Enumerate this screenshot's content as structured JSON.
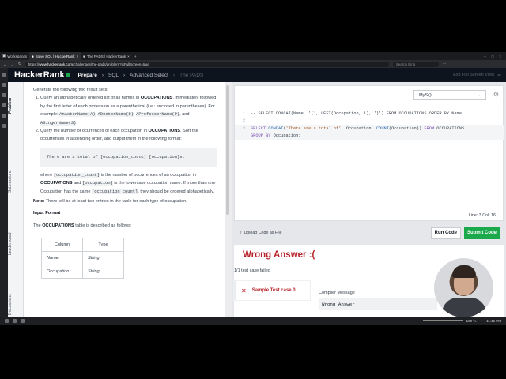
{
  "browser": {
    "tabs": [
      {
        "label": "Workspaces",
        "active": false
      },
      {
        "label": "Solve SQL | HackerRank",
        "active": true
      },
      {
        "label": "The PADS | HackerRank",
        "active": false
      }
    ],
    "url_prefix": "https://",
    "url_domain": "www.hackerrank.com",
    "url_path": "/challenges/the-pads/problem?isFullScreen=true",
    "search_placeholder": "Search Bing"
  },
  "header": {
    "logo": "HackerRank",
    "crumbs": [
      "Prepare",
      "SQL",
      "Advanced Select",
      "The PADS"
    ],
    "exit_fullscreen": "Exit Full Screen View"
  },
  "sidebar": {
    "tabs": [
      "Problem",
      "Submissions",
      "Leaderboard",
      "Discussions"
    ]
  },
  "problem": {
    "intro": "Generate the following two result sets:",
    "item1": {
      "pre": "Query an alphabetically ordered list of all names in ",
      "table": "OCCUPATIONS",
      "mid": ", immediately followed by the first letter of each profession as a parenthetical (i.e.: enclosed in parentheses). For example: ",
      "ex1": "AnActorName(A)",
      "sep1": ", ",
      "ex2": "ADoctorName(D)",
      "sep2": ", ",
      "ex3": "AProfessorName(P)",
      "sep3": ", and ",
      "ex4": "ASingerName(S)",
      "end": "."
    },
    "item2": {
      "pre": "Query the number of ocurrences of each occupation in ",
      "table": "OCCUPATIONS",
      "post": ". Sort the occurrences in ascending order, and output them in the following format:"
    },
    "format_code": "There are a total of [occupation_count] [occupation]s.",
    "where": {
      "w1": "where ",
      "c1": "[occupation_count]",
      "w2": " is the number of occurrences of an occupation in ",
      "t1": "OCCUPATIONS",
      "w3": " and ",
      "c2": "[occupation]",
      "w4": " is the lowercase occupation name. If more than one Occupation has the same ",
      "c3": "[occupation_count]",
      "w5": ", they should be ordered alphabetically."
    },
    "note_label": "Note:",
    "note_text": " There will be at least two entries in the table for each type of occupation.",
    "input_format": "Input Format",
    "table_desc_pre": "The ",
    "table_desc_name": "OCCUPATIONS",
    "table_desc_post": " table is described as follows:",
    "columns_header": [
      "Column",
      "Type"
    ],
    "columns": [
      [
        "Name",
        "String"
      ],
      [
        "Occupation",
        "String"
      ]
    ]
  },
  "editor": {
    "language": "MySQL",
    "line_numbers": [
      "1",
      "2",
      "3"
    ],
    "line1": "-- SELECT CONCAT(Name, '(', LEFT(Occupation, 1), ')') FROM OCCUPATIONS ORDER BY Name;",
    "line3_kw1": "SELECT ",
    "line3_fn1": "CONCAT",
    "line3_p1": "(",
    "line3_str": "'There are a total of'",
    "line3_p2": ", Occupation, ",
    "line3_fn2": "COUNT",
    "line3_p3": "(Occupation)) ",
    "line3_kw2": "FROM",
    "line3_p4": " OCCUPATIONS",
    "line3b_kw": "GROUP BY",
    "line3b_p": " Occupation;",
    "cursor_pos": "Line: 3 Col: 16"
  },
  "actions": {
    "upload": "Upload Code as File",
    "run": "Run Code",
    "submit": "Submit Code"
  },
  "result": {
    "status": "Wrong Answer :(",
    "summary": "1/1 test case failed",
    "test_case": "Sample Test case 0",
    "compiler_label": "Compiler Message",
    "compiler_output": "Wrong Answer"
  },
  "taskbar": {
    "zoom": "100 %",
    "time": "11:45 PM"
  },
  "colors": {
    "brand_green": "#1ba94c",
    "header_bg": "#0e141e",
    "error_red": "#b8232b"
  }
}
